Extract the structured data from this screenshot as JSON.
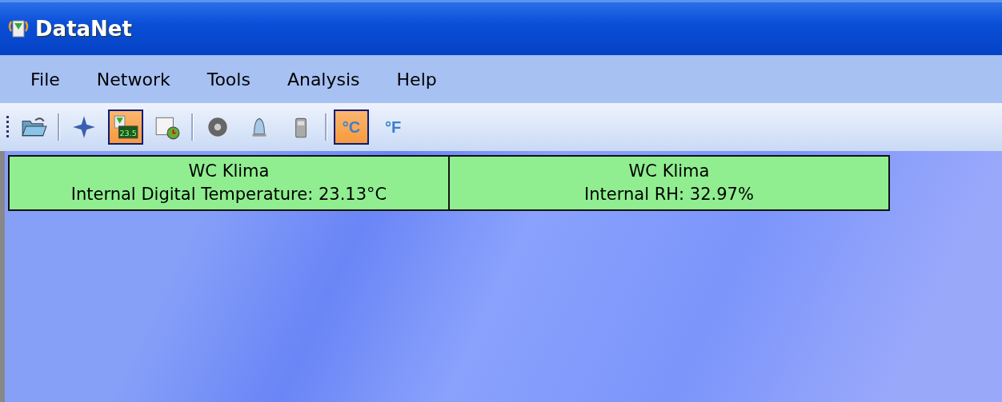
{
  "window": {
    "title": "DataNet"
  },
  "menu": [
    "File",
    "Network",
    "Tools",
    "Analysis",
    "Help"
  ],
  "toolbar": [
    {
      "kind": "open",
      "selected": false
    },
    {
      "kind": "separator"
    },
    {
      "kind": "star",
      "selected": false
    },
    {
      "kind": "display",
      "label": "23.5",
      "selected": true
    },
    {
      "kind": "calendar",
      "selected": false
    },
    {
      "kind": "separator"
    },
    {
      "kind": "disc",
      "selected": false
    },
    {
      "kind": "bell",
      "selected": false
    },
    {
      "kind": "phone",
      "selected": false
    },
    {
      "kind": "separator"
    },
    {
      "kind": "unit",
      "label": "°C",
      "selected": true
    },
    {
      "kind": "unit",
      "label": "°F",
      "selected": false
    }
  ],
  "sensors": [
    {
      "name": "WC Klima",
      "reading": "Internal Digital Temperature: 23.13°C"
    },
    {
      "name": "WC Klima",
      "reading": "Internal RH: 32.97%"
    }
  ]
}
